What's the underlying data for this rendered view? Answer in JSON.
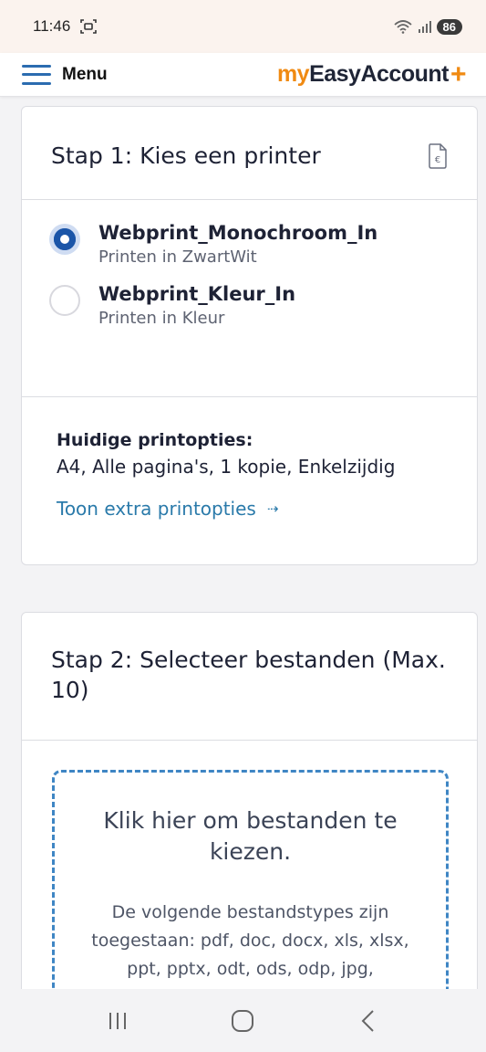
{
  "status_bar": {
    "time": "11:46",
    "battery": "86"
  },
  "topbar": {
    "menu_label": "Menu",
    "brand_my": "my",
    "brand_rest": "EasyAccount",
    "brand_plus": "+"
  },
  "step1": {
    "title": "Stap 1: Kies een printer",
    "printers": [
      {
        "name": "Webprint_Monochroom_In",
        "description": "Printen in ZwartWit",
        "selected": true
      },
      {
        "name": "Webprint_Kleur_In",
        "description": "Printen in Kleur",
        "selected": false
      }
    ],
    "options_heading": "Huidige printopties:",
    "options_value": "A4, Alle pagina's, 1 kopie, Enkelzijdig",
    "options_link": "Toon extra printopties"
  },
  "step2": {
    "title": "Stap 2: Selecteer bestanden (Max. 10)",
    "dropzone_title": "Klik hier om bestanden te kiezen.",
    "dropzone_text": "De volgende bestandstypes zijn toegestaan: pdf, doc, docx, xls, xlsx, ppt, pptx, odt, ods, odp, jpg,"
  },
  "colors": {
    "brand_orange": "#f08a12",
    "link_blue": "#2a7aaa",
    "radio_blue": "#1b55a8"
  }
}
